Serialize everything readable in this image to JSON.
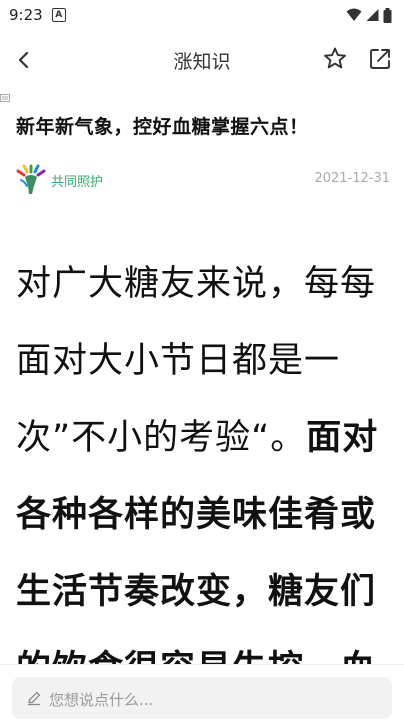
{
  "status_bar": {
    "time": "9:23",
    "app_indicator": "A"
  },
  "header": {
    "title": "涨知识"
  },
  "article": {
    "title": "新年新气象，控好血糖掌握六点！",
    "author": "共同照护",
    "date": "2021-12-31",
    "body_normal": "对广大糖友来说，每每面对大小节日都是一次”不小的考验“。",
    "body_bold": "面对各种各样的美味佳肴或生活节奏改变，糖友们的饮食很容易失控，血"
  },
  "comment": {
    "placeholder": "您想说点什么..."
  },
  "icons": {
    "back": "chevron-left-icon",
    "favorite": "star-icon",
    "share": "share-icon",
    "pencil": "pencil-icon",
    "wifi": "wifi-icon",
    "signal": "signal-icon",
    "battery": "battery-icon"
  },
  "colors": {
    "author": "#2fae6b",
    "date": "#aaaaaa",
    "input_bg": "#f2f2f2"
  }
}
